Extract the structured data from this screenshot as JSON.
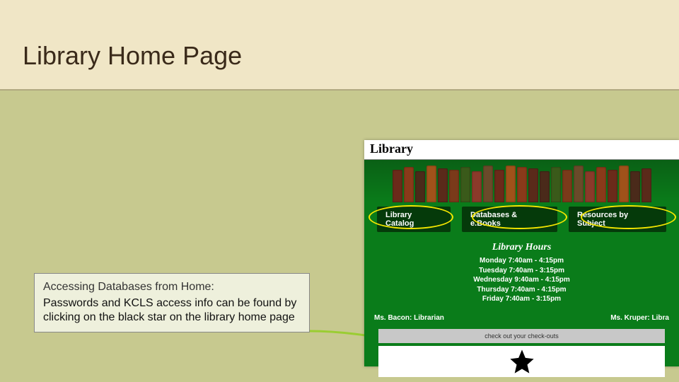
{
  "title": "Library Home Page",
  "callout": {
    "heading": "Accessing Databases from Home:",
    "body": "Passwords and KCLS access info can be found by clicking on the black star on the library home page"
  },
  "libpage": {
    "header": "Library",
    "tabs": [
      "Library Catalog",
      "Databases & e.Books",
      "Resources by Subject"
    ],
    "hours_title": "Library Hours",
    "hours": [
      "Monday 7:40am - 4:15pm",
      "Tuesday 7:40am - 3:15pm",
      "Wednesday 9:40am - 4:15pm",
      "Thursday 7:40am - 4:15pm",
      "Friday 7:40am - 3:15pm"
    ],
    "staff_left": "Ms. Bacon: Librarian",
    "staff_right": "Ms. Kruper: Libra",
    "checkouts": "check out your check-outs"
  },
  "icons": {
    "star": "star-icon"
  },
  "colors": {
    "highlight_ring": "#f4e600",
    "arrow": "#9acd32",
    "lib_green": "#0a7c1a"
  }
}
